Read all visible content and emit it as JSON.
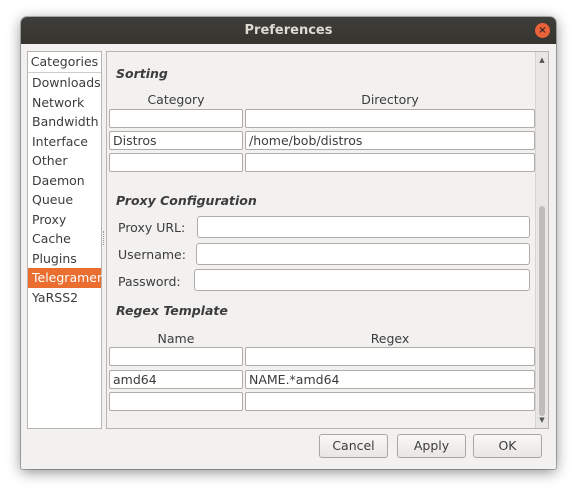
{
  "window": {
    "title": "Preferences",
    "close_glyph": "×"
  },
  "sidebar": {
    "header": "Categories",
    "items": [
      {
        "label": "Downloads",
        "selected": false
      },
      {
        "label": "Network",
        "selected": false
      },
      {
        "label": "Bandwidth",
        "selected": false
      },
      {
        "label": "Interface",
        "selected": false
      },
      {
        "label": "Other",
        "selected": false
      },
      {
        "label": "Daemon",
        "selected": false
      },
      {
        "label": "Queue",
        "selected": false
      },
      {
        "label": "Proxy",
        "selected": false
      },
      {
        "label": "Cache",
        "selected": false
      },
      {
        "label": "Plugins",
        "selected": false
      },
      {
        "label": "Telegramer",
        "selected": true
      },
      {
        "label": "YaRSS2",
        "selected": false
      }
    ]
  },
  "sorting": {
    "title": "Sorting",
    "col_category": "Category",
    "col_directory": "Directory",
    "rows": [
      {
        "category": "",
        "directory": ""
      },
      {
        "category": "Distros",
        "directory": "/home/bob/distros"
      },
      {
        "category": "",
        "directory": ""
      }
    ]
  },
  "proxy": {
    "title": "Proxy Configuration",
    "url_label": "Proxy URL:",
    "url_value": "",
    "username_label": "Username:",
    "username_value": "",
    "password_label": "Password:",
    "password_value": ""
  },
  "regex": {
    "title": "Regex Template",
    "col_name": "Name",
    "col_regex": "Regex",
    "rows": [
      {
        "name": "",
        "regex": ""
      },
      {
        "name": "amd64",
        "regex": "NAME.*amd64"
      },
      {
        "name": "",
        "regex": ""
      }
    ]
  },
  "scrollbar": {
    "up_glyph": "▲",
    "down_glyph": "▼"
  },
  "buttons": {
    "cancel": "Cancel",
    "apply": "Apply",
    "ok": "OK"
  },
  "colors": {
    "accent": "#e96e30",
    "close": "#e9623a",
    "titlebar": "#3a3935"
  }
}
